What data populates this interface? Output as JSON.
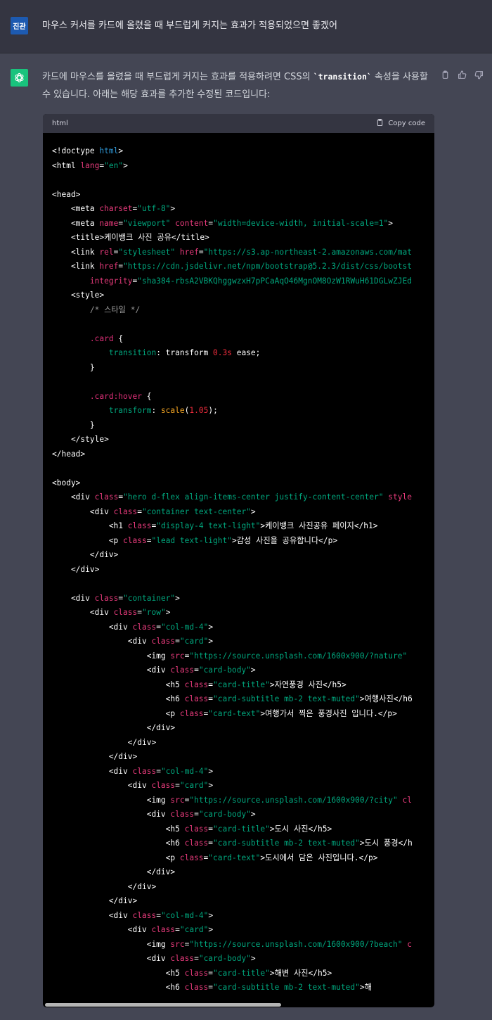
{
  "user": {
    "avatar_label": "진관",
    "message": "마우스 커서를 카드에 올렸을 때 부드럽게 커지는 효과가 적용되었으면 좋겠어"
  },
  "assistant": {
    "avatar_icon": "openai-logo-icon",
    "text_before": "카드에 마우스를 올렸을 때 부드럽게 커지는 효과를 적용하려면 CSS의 ",
    "inline_code": "`transition`",
    "text_after": " 속성을 사용할 수 있습니다. 아래는 해당 효과를 추가한 수정된 코드입니다:"
  },
  "actions": {
    "icons": [
      "clipboard-icon",
      "thumbs-up-icon",
      "thumbs-down-icon"
    ]
  },
  "code_block": {
    "language": "html",
    "copy_label": "Copy code",
    "lines": [
      [
        [
          "t",
          "<!doctype "
        ],
        [
          "k",
          "html"
        ],
        [
          "t",
          ">"
        ]
      ],
      [
        [
          "t",
          "<html "
        ],
        [
          "a",
          "lang"
        ],
        [
          "t",
          "="
        ],
        [
          "s",
          "\"en\""
        ],
        [
          "t",
          ">"
        ]
      ],
      [],
      [
        [
          "t",
          "<head>"
        ]
      ],
      [
        [
          "t",
          "    <meta "
        ],
        [
          "a",
          "charset"
        ],
        [
          "t",
          "="
        ],
        [
          "s",
          "\"utf-8\""
        ],
        [
          "t",
          ">"
        ]
      ],
      [
        [
          "t",
          "    <meta "
        ],
        [
          "a",
          "name"
        ],
        [
          "t",
          "="
        ],
        [
          "s",
          "\"viewport\""
        ],
        [
          "t",
          " "
        ],
        [
          "a",
          "content"
        ],
        [
          "t",
          "="
        ],
        [
          "s",
          "\"width=device-width, initial-scale=1\""
        ],
        [
          "t",
          ">"
        ]
      ],
      [
        [
          "t",
          "    <title>케이뱅크 사진 공유</title>"
        ]
      ],
      [
        [
          "t",
          "    <link "
        ],
        [
          "a",
          "rel"
        ],
        [
          "t",
          "="
        ],
        [
          "s",
          "\"stylesheet\""
        ],
        [
          "t",
          " "
        ],
        [
          "a",
          "href"
        ],
        [
          "t",
          "="
        ],
        [
          "s",
          "\"https://s3.ap-northeast-2.amazonaws.com/mat"
        ]
      ],
      [
        [
          "t",
          "    <link "
        ],
        [
          "a",
          "href"
        ],
        [
          "t",
          "="
        ],
        [
          "s",
          "\"https://cdn.jsdelivr.net/npm/bootstrap@5.2.3/dist/css/bootst"
        ]
      ],
      [
        [
          "t",
          "        "
        ],
        [
          "a",
          "integrity"
        ],
        [
          "t",
          "="
        ],
        [
          "s",
          "\"sha384-rbsA2VBKQhggwzxH7pPCaAqO46MgnOM8OzW1RWuH61DGLwZJEd"
        ]
      ],
      [
        [
          "t",
          "    <style>"
        ]
      ],
      [
        [
          "t",
          "        "
        ],
        [
          "c",
          "/* 스타일 */"
        ]
      ],
      [],
      [
        [
          "t",
          "        "
        ],
        [
          "n",
          ".card"
        ],
        [
          "t",
          " {"
        ]
      ],
      [
        [
          "t",
          "            "
        ],
        [
          "s",
          "transition"
        ],
        [
          "t",
          ": transform "
        ],
        [
          "v",
          "0.3s"
        ],
        [
          "t",
          " ease;"
        ]
      ],
      [
        [
          "t",
          "        }"
        ]
      ],
      [],
      [
        [
          "t",
          "        "
        ],
        [
          "n",
          ".card:hover"
        ],
        [
          "t",
          " {"
        ]
      ],
      [
        [
          "t",
          "            "
        ],
        [
          "s",
          "transform"
        ],
        [
          "t",
          ": "
        ],
        [
          "f",
          "scale"
        ],
        [
          "t",
          "("
        ],
        [
          "v",
          "1.05"
        ],
        [
          "t",
          ");"
        ]
      ],
      [
        [
          "t",
          "        }"
        ]
      ],
      [
        [
          "t",
          "    </style>"
        ]
      ],
      [
        [
          "t",
          "</head>"
        ]
      ],
      [],
      [
        [
          "t",
          "<body>"
        ]
      ],
      [
        [
          "t",
          "    <div "
        ],
        [
          "a",
          "class"
        ],
        [
          "t",
          "="
        ],
        [
          "s",
          "\"hero d-flex align-items-center justify-content-center\""
        ],
        [
          "t",
          " "
        ],
        [
          "a",
          "style"
        ]
      ],
      [
        [
          "t",
          "        <div "
        ],
        [
          "a",
          "class"
        ],
        [
          "t",
          "="
        ],
        [
          "s",
          "\"container text-center\""
        ],
        [
          "t",
          ">"
        ]
      ],
      [
        [
          "t",
          "            <h1 "
        ],
        [
          "a",
          "class"
        ],
        [
          "t",
          "="
        ],
        [
          "s",
          "\"display-4 text-light\""
        ],
        [
          "t",
          ">케이뱅크 사진공유 페이지</h1>"
        ]
      ],
      [
        [
          "t",
          "            <p "
        ],
        [
          "a",
          "class"
        ],
        [
          "t",
          "="
        ],
        [
          "s",
          "\"lead text-light\""
        ],
        [
          "t",
          ">감성 사진을 공유합니다</p>"
        ]
      ],
      [
        [
          "t",
          "        </div>"
        ]
      ],
      [
        [
          "t",
          "    </div>"
        ]
      ],
      [],
      [
        [
          "t",
          "    <div "
        ],
        [
          "a",
          "class"
        ],
        [
          "t",
          "="
        ],
        [
          "s",
          "\"container\""
        ],
        [
          "t",
          ">"
        ]
      ],
      [
        [
          "t",
          "        <div "
        ],
        [
          "a",
          "class"
        ],
        [
          "t",
          "="
        ],
        [
          "s",
          "\"row\""
        ],
        [
          "t",
          ">"
        ]
      ],
      [
        [
          "t",
          "            <div "
        ],
        [
          "a",
          "class"
        ],
        [
          "t",
          "="
        ],
        [
          "s",
          "\"col-md-4\""
        ],
        [
          "t",
          ">"
        ]
      ],
      [
        [
          "t",
          "                <div "
        ],
        [
          "a",
          "class"
        ],
        [
          "t",
          "="
        ],
        [
          "s",
          "\"card\""
        ],
        [
          "t",
          ">"
        ]
      ],
      [
        [
          "t",
          "                    <img "
        ],
        [
          "a",
          "src"
        ],
        [
          "t",
          "="
        ],
        [
          "s",
          "\"https://source.unsplash.com/1600x900/?nature\""
        ]
      ],
      [
        [
          "t",
          "                    <div "
        ],
        [
          "a",
          "class"
        ],
        [
          "t",
          "="
        ],
        [
          "s",
          "\"card-body\""
        ],
        [
          "t",
          ">"
        ]
      ],
      [
        [
          "t",
          "                        <h5 "
        ],
        [
          "a",
          "class"
        ],
        [
          "t",
          "="
        ],
        [
          "s",
          "\"card-title\""
        ],
        [
          "t",
          ">자연풍경 사진</h5>"
        ]
      ],
      [
        [
          "t",
          "                        <h6 "
        ],
        [
          "a",
          "class"
        ],
        [
          "t",
          "="
        ],
        [
          "s",
          "\"card-subtitle mb-2 text-muted\""
        ],
        [
          "t",
          ">여행사진</h6"
        ]
      ],
      [
        [
          "t",
          "                        <p "
        ],
        [
          "a",
          "class"
        ],
        [
          "t",
          "="
        ],
        [
          "s",
          "\"card-text\""
        ],
        [
          "t",
          ">여행가서 찍은 풍경사진 입니다.</p>"
        ]
      ],
      [
        [
          "t",
          "                    </div>"
        ]
      ],
      [
        [
          "t",
          "                </div>"
        ]
      ],
      [
        [
          "t",
          "            </div>"
        ]
      ],
      [
        [
          "t",
          "            <div "
        ],
        [
          "a",
          "class"
        ],
        [
          "t",
          "="
        ],
        [
          "s",
          "\"col-md-4\""
        ],
        [
          "t",
          ">"
        ]
      ],
      [
        [
          "t",
          "                <div "
        ],
        [
          "a",
          "class"
        ],
        [
          "t",
          "="
        ],
        [
          "s",
          "\"card\""
        ],
        [
          "t",
          ">"
        ]
      ],
      [
        [
          "t",
          "                    <img "
        ],
        [
          "a",
          "src"
        ],
        [
          "t",
          "="
        ],
        [
          "s",
          "\"https://source.unsplash.com/1600x900/?city\""
        ],
        [
          "t",
          " "
        ],
        [
          "a",
          "cl"
        ]
      ],
      [
        [
          "t",
          "                    <div "
        ],
        [
          "a",
          "class"
        ],
        [
          "t",
          "="
        ],
        [
          "s",
          "\"card-body\""
        ],
        [
          "t",
          ">"
        ]
      ],
      [
        [
          "t",
          "                        <h5 "
        ],
        [
          "a",
          "class"
        ],
        [
          "t",
          "="
        ],
        [
          "s",
          "\"card-title\""
        ],
        [
          "t",
          ">도시 사진</h5>"
        ]
      ],
      [
        [
          "t",
          "                        <h6 "
        ],
        [
          "a",
          "class"
        ],
        [
          "t",
          "="
        ],
        [
          "s",
          "\"card-subtitle mb-2 text-muted\""
        ],
        [
          "t",
          ">도시 풍경</h"
        ]
      ],
      [
        [
          "t",
          "                        <p "
        ],
        [
          "a",
          "class"
        ],
        [
          "t",
          "="
        ],
        [
          "s",
          "\"card-text\""
        ],
        [
          "t",
          ">도시에서 담은 사진입니다.</p>"
        ]
      ],
      [
        [
          "t",
          "                    </div>"
        ]
      ],
      [
        [
          "t",
          "                </div>"
        ]
      ],
      [
        [
          "t",
          "            </div>"
        ]
      ],
      [
        [
          "t",
          "            <div "
        ],
        [
          "a",
          "class"
        ],
        [
          "t",
          "="
        ],
        [
          "s",
          "\"col-md-4\""
        ],
        [
          "t",
          ">"
        ]
      ],
      [
        [
          "t",
          "                <div "
        ],
        [
          "a",
          "class"
        ],
        [
          "t",
          "="
        ],
        [
          "s",
          "\"card\""
        ],
        [
          "t",
          ">"
        ]
      ],
      [
        [
          "t",
          "                    <img "
        ],
        [
          "a",
          "src"
        ],
        [
          "t",
          "="
        ],
        [
          "s",
          "\"https://source.unsplash.com/1600x900/?beach\""
        ],
        [
          "t",
          " "
        ],
        [
          "a",
          "c"
        ]
      ],
      [
        [
          "t",
          "                    <div "
        ],
        [
          "a",
          "class"
        ],
        [
          "t",
          "="
        ],
        [
          "s",
          "\"card-body\""
        ],
        [
          "t",
          ">"
        ]
      ],
      [
        [
          "t",
          "                        <h5 "
        ],
        [
          "a",
          "class"
        ],
        [
          "t",
          "="
        ],
        [
          "s",
          "\"card-title\""
        ],
        [
          "t",
          ">해변 사진</h5>"
        ]
      ],
      [
        [
          "t",
          "                        <h6 "
        ],
        [
          "a",
          "class"
        ],
        [
          "t",
          "="
        ],
        [
          "s",
          "\"card-subtitle mb-2 text-muted\""
        ],
        [
          "t",
          ">해"
        ]
      ]
    ]
  }
}
